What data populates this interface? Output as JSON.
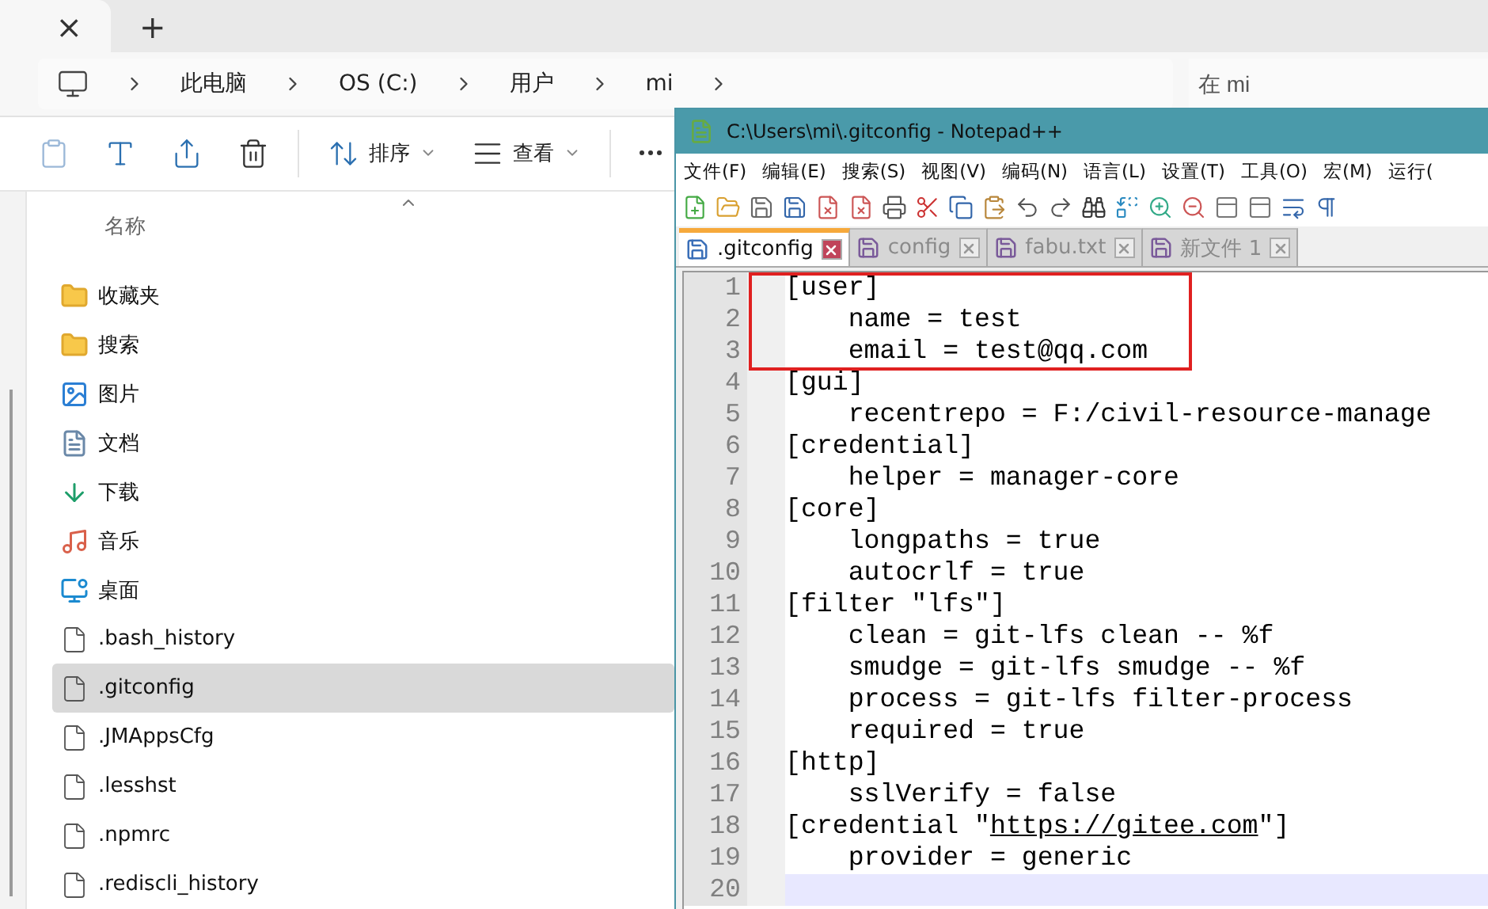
{
  "explorer": {
    "tab": {
      "close": "×"
    },
    "new_tab": "+",
    "breadcrumb": [
      "此电脑",
      "OS (C:)",
      "用户",
      "mi"
    ],
    "search": {
      "placeholder": "在 mi"
    },
    "toolbar": [
      {
        "kind": "paste"
      },
      {
        "kind": "rename"
      },
      {
        "kind": "share"
      },
      {
        "kind": "delete"
      },
      {
        "kind": "sort",
        "label": "排序"
      },
      {
        "kind": "view",
        "label": "查看"
      },
      {
        "kind": "more"
      }
    ],
    "column_header": "名称",
    "items": [
      {
        "kind": "folder",
        "name": "收藏夹",
        "selected": false
      },
      {
        "kind": "folder",
        "name": "搜索",
        "selected": false
      },
      {
        "kind": "pictures",
        "name": "图片",
        "selected": false
      },
      {
        "kind": "documents",
        "name": "文档",
        "selected": false
      },
      {
        "kind": "downloads",
        "name": "下载",
        "selected": false
      },
      {
        "kind": "music",
        "name": "音乐",
        "selected": false
      },
      {
        "kind": "desktop",
        "name": "桌面",
        "selected": false
      },
      {
        "kind": "file",
        "name": ".bash_history",
        "selected": false
      },
      {
        "kind": "file",
        "name": ".gitconfig",
        "selected": true
      },
      {
        "kind": "file",
        "name": ".JMAppsCfg",
        "selected": false
      },
      {
        "kind": "file",
        "name": ".lesshst",
        "selected": false
      },
      {
        "kind": "file",
        "name": ".npmrc",
        "selected": false
      },
      {
        "kind": "file",
        "name": ".rediscli_history",
        "selected": false
      }
    ]
  },
  "notepad": {
    "title": "C:\\Users\\mi\\.gitconfig - Notepad++",
    "menu": [
      "文件(F)",
      "编辑(E)",
      "搜索(S)",
      "视图(V)",
      "编码(N)",
      "语言(L)",
      "设置(T)",
      "工具(O)",
      "宏(M)",
      "运行("
    ],
    "tabs": [
      {
        "label": ".gitconfig",
        "selected": true
      },
      {
        "label": "config",
        "selected": false
      },
      {
        "label": "fabu.txt",
        "selected": false
      },
      {
        "label": "新文件 1",
        "selected": false
      }
    ],
    "lines": [
      {
        "number": "1",
        "text": "[user]",
        "boxed": true,
        "current": false
      },
      {
        "number": "2",
        "text": "    name = test",
        "boxed": true,
        "current": false
      },
      {
        "number": "3",
        "text": "    email = test@qq.com",
        "boxed": true,
        "current": false
      },
      {
        "number": "4",
        "text": "[gui]",
        "boxed": false,
        "current": false
      },
      {
        "number": "5",
        "text": "    recentrepo = F:/civil-resource-manage",
        "boxed": false,
        "current": false
      },
      {
        "number": "6",
        "text": "[credential]",
        "boxed": false,
        "current": false
      },
      {
        "number": "7",
        "text": "    helper = manager-core",
        "boxed": false,
        "current": false
      },
      {
        "number": "8",
        "text": "[core]",
        "boxed": false,
        "current": false
      },
      {
        "number": "9",
        "text": "    longpaths = true",
        "boxed": false,
        "current": false
      },
      {
        "number": "10",
        "text": "    autocrlf = true",
        "boxed": false,
        "current": false
      },
      {
        "number": "11",
        "text": "[filter \"lfs\"]",
        "boxed": false,
        "current": false
      },
      {
        "number": "12",
        "text": "    clean = git-lfs clean -- %f",
        "boxed": false,
        "current": false
      },
      {
        "number": "13",
        "text": "    smudge = git-lfs smudge -- %f",
        "boxed": false,
        "current": false
      },
      {
        "number": "14",
        "text": "    process = git-lfs filter-process",
        "boxed": false,
        "current": false
      },
      {
        "number": "15",
        "text": "    required = true",
        "boxed": false,
        "current": false
      },
      {
        "number": "16",
        "text": "[http]",
        "boxed": false,
        "current": false
      },
      {
        "number": "17",
        "text": "    sslVerify = false",
        "boxed": false,
        "current": false
      },
      {
        "number": "18",
        "text": "[credential \"",
        "link": "https://gitee.com",
        "after": "\"]",
        "boxed": false,
        "current": false
      },
      {
        "number": "19",
        "text": "    provider = generic",
        "boxed": false,
        "current": false
      },
      {
        "number": "20",
        "boxed": false,
        "current": true
      }
    ]
  }
}
